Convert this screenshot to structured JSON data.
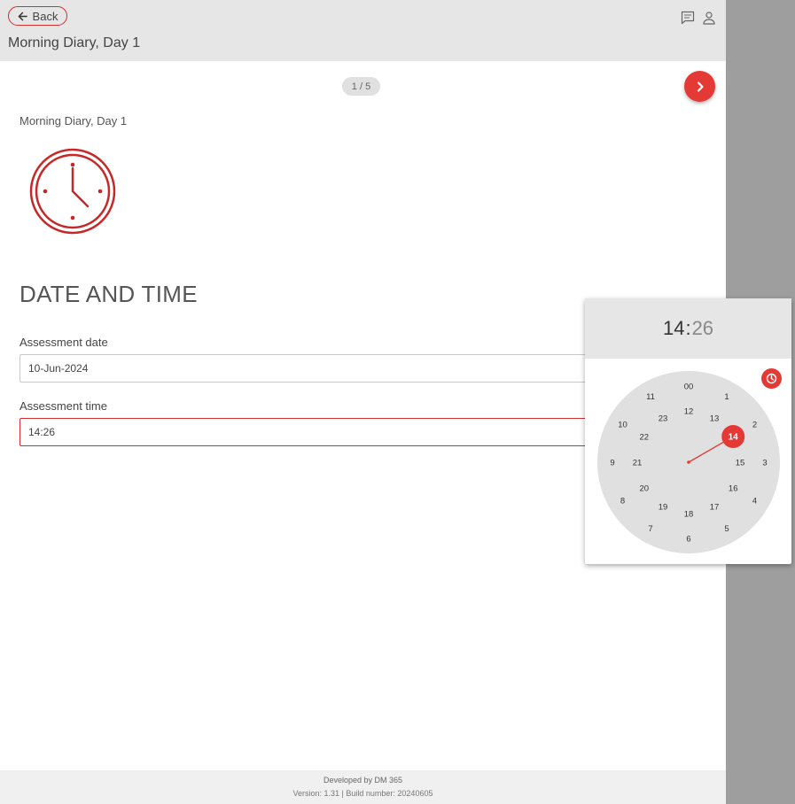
{
  "header": {
    "back_label": "Back",
    "title": "Morning Diary, Day 1",
    "icons": [
      "chat-icon",
      "user-icon"
    ]
  },
  "pager": {
    "label": "1 / 5"
  },
  "content": {
    "subtitle": "Morning Diary, Day 1",
    "section_heading": "DATE AND TIME",
    "fields": [
      {
        "label": "Assessment date",
        "value": "10-Jun-2024"
      },
      {
        "label": "Assessment time",
        "value": "14:26"
      }
    ]
  },
  "time_picker": {
    "hour": "14",
    "separator": ":",
    "minute": "26",
    "selected_hour": "14",
    "outer_hours": [
      "00",
      "1",
      "2",
      "3",
      "4",
      "5",
      "6",
      "7",
      "8",
      "9",
      "10",
      "11"
    ],
    "inner_hours": [
      "12",
      "13",
      "14",
      "15",
      "16",
      "17",
      "18",
      "19",
      "20",
      "21",
      "22",
      "23"
    ]
  },
  "footer": {
    "developed_by": "Developed by DM 365",
    "version": "Version: 1.31 | Build number: 20240605"
  },
  "colors": {
    "accent": "#e53935",
    "header_bg": "#e6e6e6",
    "side_bg": "#9e9e9e",
    "clock_icon": "#c62828"
  }
}
